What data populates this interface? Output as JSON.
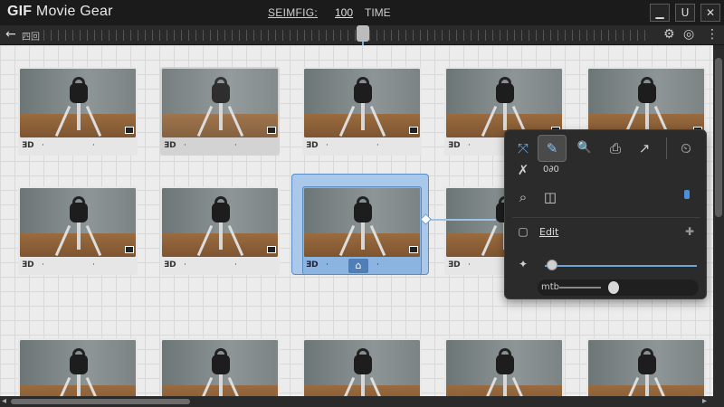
{
  "window": {
    "title_bold": "GIF",
    "title_rest": " Movie Gear",
    "frame_label": "SEIMFIG:",
    "frame_count": "100",
    "time_label": "TIME",
    "minimize_glyph": "▁",
    "maximize_glyph": "U",
    "close_glyph": "✕"
  },
  "toolbar": {
    "back_glyph": "←",
    "label": "四回",
    "settings_glyph": "⚙",
    "target_glyph": "◎",
    "more_glyph": "⋮"
  },
  "frames": {
    "meta_icon": "ƎD",
    "dot": "·",
    "selected_home_glyph": "⌂"
  },
  "panel": {
    "coord_text": "0∂0",
    "edit_label": "Edit",
    "slider_label": "mtb",
    "slider1_level": 0.05,
    "slider2_level": 0.4,
    "icons": {
      "crop": "⤧",
      "pen": "✎",
      "zoom": "🔍",
      "print": "⎙",
      "wand": "↗",
      "timer": "⏲",
      "crossed": "✗",
      "search": "⌕",
      "comment": "◫",
      "edit_box": "▢",
      "plus": "✚",
      "fx": "✦"
    }
  },
  "colors": {
    "accent": "#5a8cc4",
    "selection": "#a9c8ea",
    "panel_bg": "#2b2b2b"
  }
}
